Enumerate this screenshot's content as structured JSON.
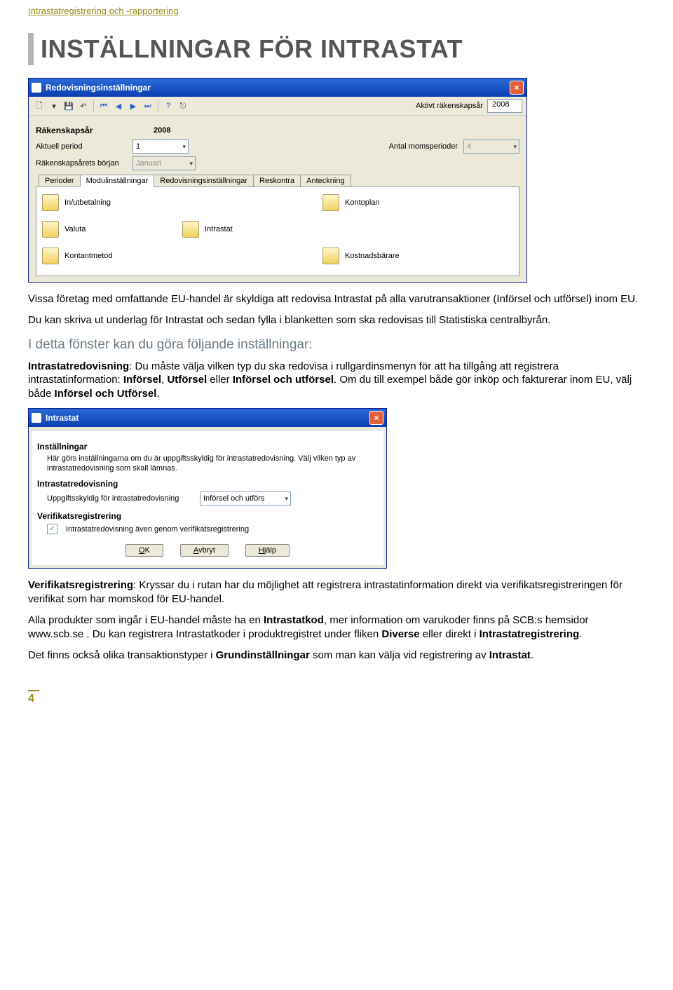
{
  "header_link": "Intrastatregistrering och -rapportering",
  "main_heading": "INSTÄLLNINGAR FÖR INTRASTAT",
  "win1": {
    "title": "Redovisningsinställningar",
    "aktivt_label": "Aktivt räkenskapsår",
    "aktivt_value": "2008",
    "section": "Räkenskapsår",
    "year_value": "2008",
    "aktuell_label": "Aktuell period",
    "aktuell_value": "1",
    "moms_label": "Antal momsperioder",
    "moms_value": "4",
    "borjan_label": "Räkenskapsårets början",
    "borjan_value": "Januari",
    "tabs": [
      "Perioder",
      "Modulinställningar",
      "Redovisningsinställningar",
      "Reskontra",
      "Anteckning"
    ],
    "active_tab": 1,
    "items": [
      {
        "label": "In/utbetalning",
        "name": "item-inutbetalning"
      },
      {
        "label": "Kontoplan",
        "name": "item-kontoplan"
      },
      {
        "label": "",
        "name": ""
      },
      {
        "label": "Valuta",
        "name": "item-valuta"
      },
      {
        "label": "Intrastat",
        "name": "item-intrastat"
      },
      {
        "label": "",
        "name": ""
      },
      {
        "label": "Kontantmetod",
        "name": "item-kontantmetod"
      },
      {
        "label": "Kostnadsbärare",
        "name": "item-kostnadsbarare"
      }
    ]
  },
  "para1": "Vissa företag med omfattande EU-handel är skyldiga att redovisa Intrastat på alla varutransaktioner (Införsel och utförsel) inom EU.",
  "para2": "Du kan skriva ut underlag för Intrastat och sedan fylla i blanketten som ska redovisas till Statistiska centralbyrån.",
  "subhead": "I detta fönster kan du göra följande inställningar:",
  "para3_a": "Intrastatredovisning",
  "para3_b": ": Du måste välja vilken typ du ska redovisa i rullgardinsmenyn för att ha tillgång att registrera intrastatinformation: ",
  "para3_c": "Införsel",
  "para3_d": ", ",
  "para3_e": "Utförsel",
  "para3_f": " eller ",
  "para3_g": "Införsel och utförsel",
  "para3_h": ". Om du till exempel både gör inköp och fakturerar inom EU, välj både ",
  "para3_i": "Införsel och Utförsel",
  "para3_j": ".",
  "win2": {
    "title": "Intrastat",
    "s_installningar": "Inställningar",
    "intro": "Här görs inställningarna om du är uppgiftsskyldig för intrastatredovisning. Välj vilken typ av intrastatredovisning som skall lämnas.",
    "s_redo": "Intrastatredovisning",
    "uppgift_label": "Uppgiftsskyldig för intrastatredovisning",
    "uppgift_value": "Införsel och utförs",
    "s_verif": "Verifikatsregistrering",
    "chk_label": "Intrastatredovisning även genom verifikatsregistrering",
    "btn_ok": "OK",
    "btn_avbryt": "Avbryt",
    "btn_hjalp": "Hjälp"
  },
  "para4_a": "Verifikatsregistrering",
  "para4_b": ": Kryssar du i rutan har du möjlighet att registrera intrastatinformation direkt via verifikatsregistreringen för verifikat som har momskod för EU-handel.",
  "para5_a": "Alla produkter som ingår i EU-handel måste ha en ",
  "para5_b": "Intrastatkod",
  "para5_c": ", mer information om varukoder finns på SCB:s hemsidor www.scb.se . Du kan registrera Intrastatkoder i produktregistret under fliken ",
  "para5_d": "Diverse",
  "para5_e": " eller direkt i ",
  "para5_f": "Intrastatregistrering",
  "para5_g": ".",
  "para6_a": "Det finns också olika transaktionstyper i ",
  "para6_b": "Grundinställningar",
  "para6_c": " som man kan välja vid registrering av ",
  "para6_d": "Intrastat",
  "para6_e": ".",
  "page_num": "4"
}
